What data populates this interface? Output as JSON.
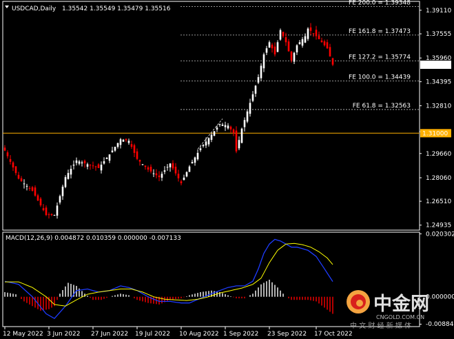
{
  "header": {
    "symbol_tf": "USDCAD,Daily",
    "ohlc": "1.35542 1.35549 1.35479 1.35516"
  },
  "macd_header": "MACD(12,26,9) 0.004872 0.010359 0.000000 -0.007133",
  "colors": {
    "background": "#000000",
    "bull": "#ffffff",
    "bear": "#ff0000",
    "fibo": "#c8c8c8",
    "hline": "#ffb000",
    "macd_line": "#1e3cff",
    "signal_line": "#ffff00",
    "axis": "#ffffff"
  },
  "chart_data": [
    {
      "type": "candlestick",
      "title": "USDCAD,Daily",
      "price_axis_ticks": [
        "1.39110",
        "1.37555",
        "1.35960",
        "1.34395",
        "1.32810",
        "1.31100",
        "1.29660",
        "1.28060",
        "1.26510",
        "1.24935"
      ],
      "ylim": [
        1.2465,
        1.3965
      ],
      "x_ticks": [
        {
          "label": "12 May 2022",
          "index": 0
        },
        {
          "label": "3 Jun 2022",
          "index": 16
        },
        {
          "label": "27 Jun 2022",
          "index": 32
        },
        {
          "label": "19 Jul 2022",
          "index": 48
        },
        {
          "label": "10 Aug 2022",
          "index": 64
        },
        {
          "label": "1 Sep 2022",
          "index": 80
        },
        {
          "label": "23 Sep 2022",
          "index": 96
        },
        {
          "label": "17 Oct 2022",
          "index": 113
        }
      ],
      "current_price": "1.35516",
      "horizontal_line": {
        "value": 1.31,
        "label": "1.31000"
      },
      "fibo_levels": [
        {
          "label": "FE 200.0 = 1.39348",
          "value": 1.39348
        },
        {
          "label": "FE 161.8 = 1.37473",
          "value": 1.37473
        },
        {
          "label": "FE 127.2 = 1.35774",
          "value": 1.35774
        },
        {
          "label": "FE 100.0 = 1.34439",
          "value": 1.34439
        },
        {
          "label": "FE 61.8 = 1.32563",
          "value": 1.32563
        }
      ],
      "trend_line": [
        {
          "index": 70,
          "value": 1.2995
        },
        {
          "index": 79,
          "value": 1.3195
        }
      ],
      "close_anchors": [
        [
          0,
          1.2985
        ],
        [
          5,
          1.28
        ],
        [
          10,
          1.272
        ],
        [
          15,
          1.256
        ],
        [
          18,
          1.256
        ],
        [
          22,
          1.281
        ],
        [
          26,
          1.292
        ],
        [
          30,
          1.2895
        ],
        [
          34,
          1.287
        ],
        [
          38,
          1.296
        ],
        [
          42,
          1.306
        ],
        [
          45,
          1.305
        ],
        [
          48,
          1.293
        ],
        [
          52,
          1.286
        ],
        [
          56,
          1.281
        ],
        [
          60,
          1.29
        ],
        [
          64,
          1.277
        ],
        [
          67,
          1.288
        ],
        [
          71,
          1.3
        ],
        [
          75,
          1.309
        ],
        [
          78,
          1.316
        ],
        [
          81,
          1.315
        ],
        [
          83,
          1.31
        ],
        [
          84,
          1.298
        ],
        [
          86,
          1.313
        ],
        [
          89,
          1.33
        ],
        [
          92,
          1.347
        ],
        [
          94,
          1.362
        ],
        [
          96,
          1.37
        ],
        [
          98,
          1.362
        ],
        [
          100,
          1.378
        ],
        [
          102,
          1.37
        ],
        [
          104,
          1.358
        ],
        [
          106,
          1.368
        ],
        [
          109,
          1.374
        ],
        [
          110,
          1.379
        ],
        [
          112,
          1.376
        ],
        [
          114,
          1.372
        ],
        [
          117,
          1.366
        ],
        [
          119,
          1.3552
        ]
      ]
    },
    {
      "type": "macd",
      "title": "MACD(12,26,9) 0.004872 0.010359 0.000000 -0.007133",
      "axis_ticks": [
        "0.020302",
        "0.000000",
        "-0.00884"
      ],
      "ylim": [
        -0.0094,
        0.0206
      ],
      "series": [
        {
          "name": "MACD",
          "anchors": [
            [
              0,
              0.005
            ],
            [
              5,
              0.004
            ],
            [
              10,
              0.0
            ],
            [
              15,
              -0.0055
            ],
            [
              18,
              -0.007
            ],
            [
              22,
              -0.003
            ],
            [
              26,
              0.002
            ],
            [
              30,
              0.0025
            ],
            [
              34,
              0.0015
            ],
            [
              38,
              0.002
            ],
            [
              42,
              0.0035
            ],
            [
              45,
              0.003
            ],
            [
              48,
              0.002
            ],
            [
              52,
              0.0
            ],
            [
              56,
              -0.0015
            ],
            [
              60,
              -0.0015
            ],
            [
              64,
              -0.002
            ],
            [
              67,
              -0.002
            ],
            [
              71,
              -0.0005
            ],
            [
              75,
              0.001
            ],
            [
              78,
              0.002
            ],
            [
              81,
              0.003
            ],
            [
              84,
              0.0035
            ],
            [
              87,
              0.0035
            ],
            [
              90,
              0.005
            ],
            [
              92,
              0.009
            ],
            [
              94,
              0.014
            ],
            [
              96,
              0.017
            ],
            [
              98,
              0.0185
            ],
            [
              100,
              0.018
            ],
            [
              102,
              0.017
            ],
            [
              104,
              0.016
            ],
            [
              106,
              0.016
            ],
            [
              108,
              0.0155
            ],
            [
              110,
              0.015
            ],
            [
              113,
              0.013
            ],
            [
              116,
              0.009
            ],
            [
              119,
              0.0049
            ]
          ]
        },
        {
          "name": "Signal",
          "anchors": [
            [
              0,
              0.0048
            ],
            [
              5,
              0.0048
            ],
            [
              10,
              0.003
            ],
            [
              15,
              0.0
            ],
            [
              18,
              -0.0025
            ],
            [
              22,
              -0.003
            ],
            [
              26,
              -0.001
            ],
            [
              30,
              0.0008
            ],
            [
              34,
              0.0015
            ],
            [
              38,
              0.002
            ],
            [
              42,
              0.0025
            ],
            [
              46,
              0.0025
            ],
            [
              50,
              0.0015
            ],
            [
              54,
              0.0
            ],
            [
              58,
              -0.0008
            ],
            [
              62,
              -0.001
            ],
            [
              66,
              -0.0012
            ],
            [
              70,
              -0.0008
            ],
            [
              74,
              0.0
            ],
            [
              78,
              0.0012
            ],
            [
              82,
              0.002
            ],
            [
              86,
              0.0028
            ],
            [
              90,
              0.004
            ],
            [
              93,
              0.006
            ],
            [
              96,
              0.011
            ],
            [
              99,
              0.015
            ],
            [
              102,
              0.017
            ],
            [
              105,
              0.0172
            ],
            [
              108,
              0.0168
            ],
            [
              111,
              0.016
            ],
            [
              114,
              0.0145
            ],
            [
              117,
              0.0125
            ],
            [
              119,
              0.0104
            ]
          ]
        },
        {
          "name": "Histogram",
          "anchors": [
            [
              0,
              0.0015
            ],
            [
              4,
              0.0008
            ],
            [
              7,
              -0.0015
            ],
            [
              10,
              -0.003
            ],
            [
              13,
              -0.0045
            ],
            [
              16,
              -0.004
            ],
            [
              18,
              -0.003
            ],
            [
              20,
              0.001
            ],
            [
              23,
              0.0045
            ],
            [
              26,
              0.0035
            ],
            [
              29,
              0.001
            ],
            [
              32,
              -0.001
            ],
            [
              35,
              -0.001
            ],
            [
              38,
              0.0
            ],
            [
              42,
              0.001
            ],
            [
              45,
              0.0005
            ],
            [
              48,
              -0.001
            ],
            [
              52,
              -0.002
            ],
            [
              56,
              -0.0025
            ],
            [
              60,
              -0.001
            ],
            [
              64,
              -0.0005
            ],
            [
              67,
              0.0005
            ],
            [
              71,
              0.0015
            ],
            [
              75,
              0.002
            ],
            [
              78,
              0.0015
            ],
            [
              81,
              0.0005
            ],
            [
              84,
              -0.0005
            ],
            [
              87,
              -0.0005
            ],
            [
              90,
              0.001
            ],
            [
              93,
              0.004
            ],
            [
              96,
              0.0055
            ],
            [
              99,
              0.003
            ],
            [
              102,
              0.0
            ],
            [
              104,
              -0.001
            ],
            [
              107,
              -0.001
            ],
            [
              110,
              -0.001
            ],
            [
              113,
              -0.0015
            ],
            [
              116,
              -0.0035
            ],
            [
              119,
              -0.0055
            ]
          ]
        }
      ]
    }
  ],
  "watermark": {
    "brand_cn": "中金网",
    "brand_en": "CNGOLD.COM.CN",
    "tagline": "中 文 财 经 新 媒 体"
  }
}
